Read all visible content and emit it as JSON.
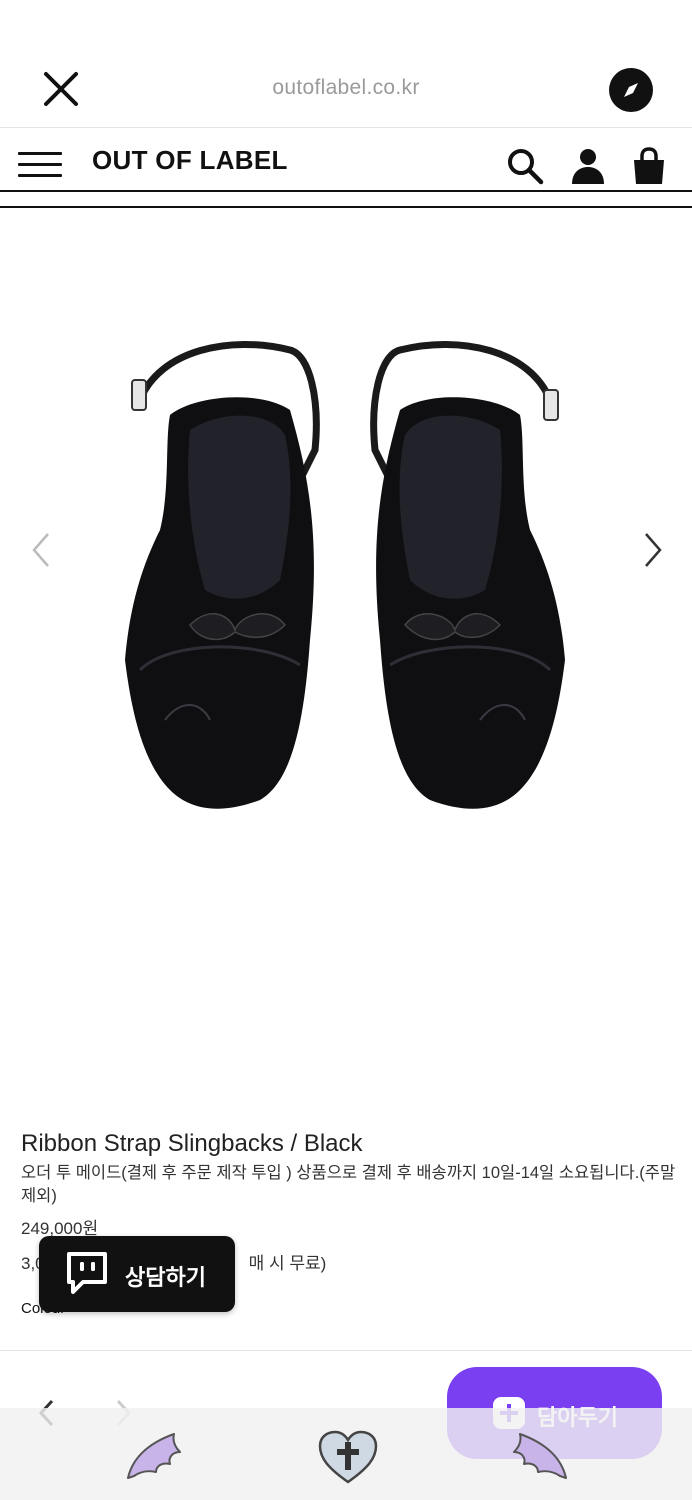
{
  "browser": {
    "url": "outoflabel.co.kr"
  },
  "header": {
    "logo": "OUT OF LABEL"
  },
  "product": {
    "name": "Ribbon Strap Slingbacks / Black",
    "description": "오더 투 메이드(결제 후 주문 제작 투입 ) 상품으로 결제 후 배송까지 10일-14일 소요됩니다.(주말제외)",
    "price": "249,000원",
    "shipping_prefix": "3,0",
    "shipping_suffix": "매 시 무료)",
    "colour_label": "Colour"
  },
  "chat": {
    "label": "상담하기"
  },
  "wishlist": {
    "label": "담아두기"
  },
  "colors": {
    "accent": "#7b3ff2",
    "deco_purple": "#c9b4ea"
  }
}
